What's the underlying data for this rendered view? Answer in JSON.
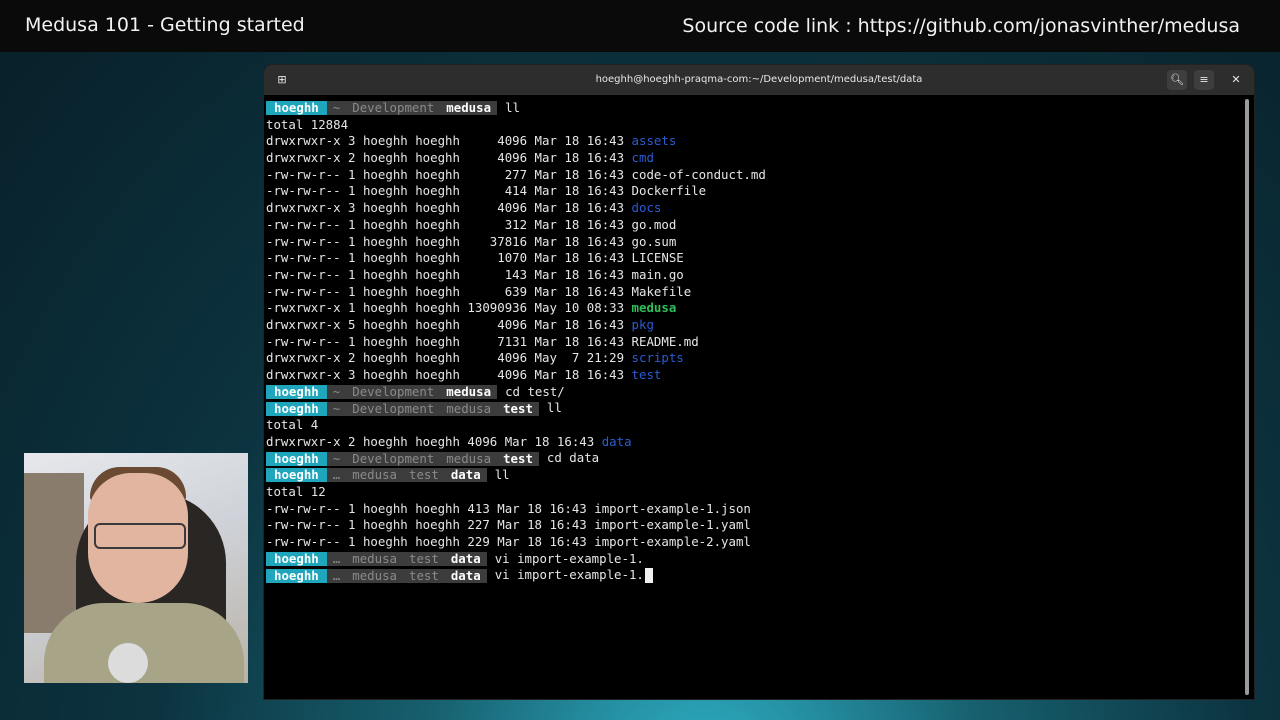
{
  "banner": {
    "title": "Medusa 101 - Getting started",
    "source": "Source code link : https://github.com/jonasvinther/medusa"
  },
  "terminal": {
    "title": "hoeghh@hoeghh-praqma-com:~/Development/medusa/test/data",
    "icons": {
      "new_tab": "new-tab-icon",
      "search": "search-icon",
      "menu": "hamburger-menu-icon",
      "close": "close-icon"
    },
    "colors": {
      "prompt_user": "#1fa6bd",
      "segment": "#3c3c3c",
      "dir": "#2a5cd4",
      "exec": "#2fbf5a"
    },
    "prompt1": {
      "user": "hoeghh",
      "path": [
        "~",
        "Development"
      ],
      "current": "medusa",
      "command": "ll"
    },
    "listing1": {
      "total": "total 12884",
      "rows": [
        {
          "meta": "drwxrwxr-x 3 hoeghh hoeghh     4096 Mar 18 16:43 ",
          "name": "assets",
          "kind": "dir"
        },
        {
          "meta": "drwxrwxr-x 2 hoeghh hoeghh     4096 Mar 18 16:43 ",
          "name": "cmd",
          "kind": "dir"
        },
        {
          "meta": "-rw-rw-r-- 1 hoeghh hoeghh      277 Mar 18 16:43 ",
          "name": "code-of-conduct.md",
          "kind": "file"
        },
        {
          "meta": "-rw-rw-r-- 1 hoeghh hoeghh      414 Mar 18 16:43 ",
          "name": "Dockerfile",
          "kind": "file"
        },
        {
          "meta": "drwxrwxr-x 3 hoeghh hoeghh     4096 Mar 18 16:43 ",
          "name": "docs",
          "kind": "dir"
        },
        {
          "meta": "-rw-rw-r-- 1 hoeghh hoeghh      312 Mar 18 16:43 ",
          "name": "go.mod",
          "kind": "file"
        },
        {
          "meta": "-rw-rw-r-- 1 hoeghh hoeghh    37816 Mar 18 16:43 ",
          "name": "go.sum",
          "kind": "file"
        },
        {
          "meta": "-rw-rw-r-- 1 hoeghh hoeghh     1070 Mar 18 16:43 ",
          "name": "LICENSE",
          "kind": "file"
        },
        {
          "meta": "-rw-rw-r-- 1 hoeghh hoeghh      143 Mar 18 16:43 ",
          "name": "main.go",
          "kind": "file"
        },
        {
          "meta": "-rw-rw-r-- 1 hoeghh hoeghh      639 Mar 18 16:43 ",
          "name": "Makefile",
          "kind": "file"
        },
        {
          "meta": "-rwxrwxr-x 1 hoeghh hoeghh 13090936 May 10 08:33 ",
          "name": "medusa",
          "kind": "exec"
        },
        {
          "meta": "drwxrwxr-x 5 hoeghh hoeghh     4096 Mar 18 16:43 ",
          "name": "pkg",
          "kind": "dir"
        },
        {
          "meta": "-rw-rw-r-- 1 hoeghh hoeghh     7131 Mar 18 16:43 ",
          "name": "README.md",
          "kind": "file"
        },
        {
          "meta": "drwxrwxr-x 2 hoeghh hoeghh     4096 May  7 21:29 ",
          "name": "scripts",
          "kind": "dir"
        },
        {
          "meta": "drwxrwxr-x 3 hoeghh hoeghh     4096 Mar 18 16:43 ",
          "name": "test",
          "kind": "dir"
        }
      ]
    },
    "prompt2": {
      "user": "hoeghh",
      "path": [
        "~",
        "Development"
      ],
      "current": "medusa",
      "command": "cd test/"
    },
    "prompt3": {
      "user": "hoeghh",
      "path": [
        "~",
        "Development",
        "medusa"
      ],
      "current": "test",
      "command": "ll"
    },
    "listing2": {
      "total": "total 4",
      "rows": [
        {
          "meta": "drwxrwxr-x 2 hoeghh hoeghh 4096 Mar 18 16:43 ",
          "name": "data",
          "kind": "dir"
        }
      ]
    },
    "prompt4": {
      "user": "hoeghh",
      "path": [
        "~",
        "Development",
        "medusa"
      ],
      "current": "test",
      "command": "cd data"
    },
    "prompt5": {
      "user": "hoeghh",
      "path": [
        "…",
        "medusa",
        "test"
      ],
      "current": "data",
      "command": "ll"
    },
    "listing3": {
      "total": "total 12",
      "rows": [
        {
          "meta": "-rw-rw-r-- 1 hoeghh hoeghh 413 Mar 18 16:43 ",
          "name": "import-example-1.json",
          "kind": "file"
        },
        {
          "meta": "-rw-rw-r-- 1 hoeghh hoeghh 227 Mar 18 16:43 ",
          "name": "import-example-1.yaml",
          "kind": "file"
        },
        {
          "meta": "-rw-rw-r-- 1 hoeghh hoeghh 229 Mar 18 16:43 ",
          "name": "import-example-2.yaml",
          "kind": "file"
        }
      ]
    },
    "prompt6": {
      "user": "hoeghh",
      "path": [
        "…",
        "medusa",
        "test"
      ],
      "current": "data",
      "command": "vi import-example-1."
    },
    "prompt7": {
      "user": "hoeghh",
      "path": [
        "…",
        "medusa",
        "test"
      ],
      "current": "data",
      "command": "vi import-example-1."
    }
  }
}
